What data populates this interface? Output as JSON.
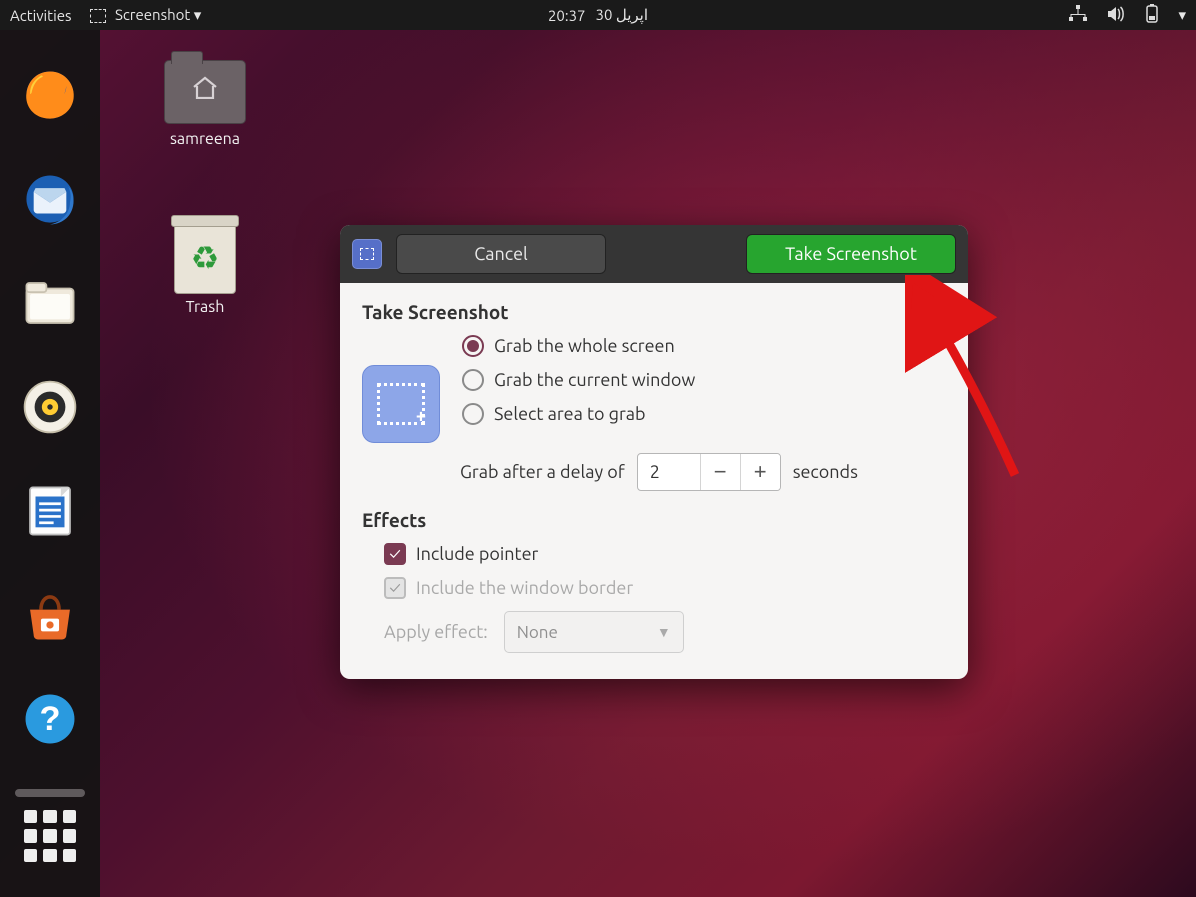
{
  "topbar": {
    "activities": "Activities",
    "app_name": "Screenshot",
    "time": "20:37",
    "date": "اپریل 30"
  },
  "desktop_icons": {
    "home_folder": "samreena",
    "trash": "Trash"
  },
  "dock": {
    "items": [
      "firefox",
      "thunderbird",
      "files",
      "rhythmbox",
      "writer",
      "software",
      "help"
    ]
  },
  "dialog": {
    "cancel": "Cancel",
    "take": "Take Screenshot",
    "section_grab": "Take Screenshot",
    "options": {
      "whole": "Grab the whole screen",
      "window": "Grab the current window",
      "area": "Select area to grab"
    },
    "selected_option": "whole",
    "delay_label_pre": "Grab after a delay of",
    "delay_value": "2",
    "delay_label_post": "seconds",
    "section_effects": "Effects",
    "include_pointer": "Include pointer",
    "include_border": "Include the window border",
    "include_pointer_checked": true,
    "include_border_checked": true,
    "include_border_enabled": false,
    "apply_effect_label": "Apply effect:",
    "apply_effect_value": "None",
    "apply_effect_enabled": false
  }
}
